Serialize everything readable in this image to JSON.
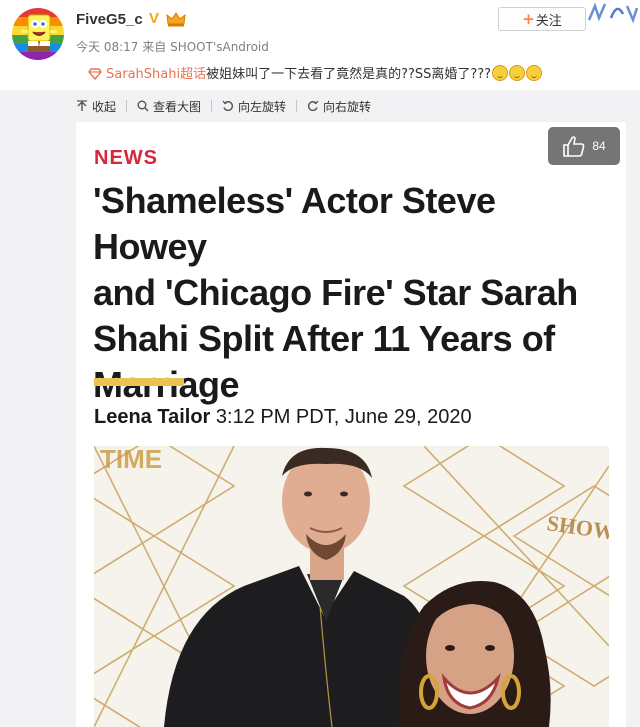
{
  "user": {
    "name": "FiveG5_c",
    "verified_mark": "V",
    "time": "今天 08:17",
    "via_prefix": "来自",
    "source": "SHOOT'sAndroid",
    "avatar_icon": "spongebob-avatar"
  },
  "follow": {
    "plus": "+",
    "label": "关注"
  },
  "post": {
    "topic": "SarahShahi超话",
    "text": "被姐妹叫了一下去看了竟然是真的??SS离婚了???",
    "emoji_count": 3
  },
  "toolbar": {
    "collapse": "收起",
    "view_large": "查看大图",
    "rotate_left": "向左旋转",
    "rotate_right": "向右旋转"
  },
  "article": {
    "likes": "84",
    "section": "NEWS",
    "headline_lines": [
      "'Shameless' Actor Steve Howey",
      "and 'Chicago Fire' Star Sarah",
      "Shahi Split After 11 Years of",
      "Marriage"
    ],
    "author": "Leena Tailor",
    "date": "3:12 PM PDT, June 29, 2020",
    "backdrop_text_left": "TIME",
    "backdrop_text_right": "SHOWTI"
  },
  "colors": {
    "news_red": "#d6263a",
    "gold_bar": "#ebc254",
    "topic_orange": "#eb7350",
    "verified_gold": "#f6a70a"
  }
}
